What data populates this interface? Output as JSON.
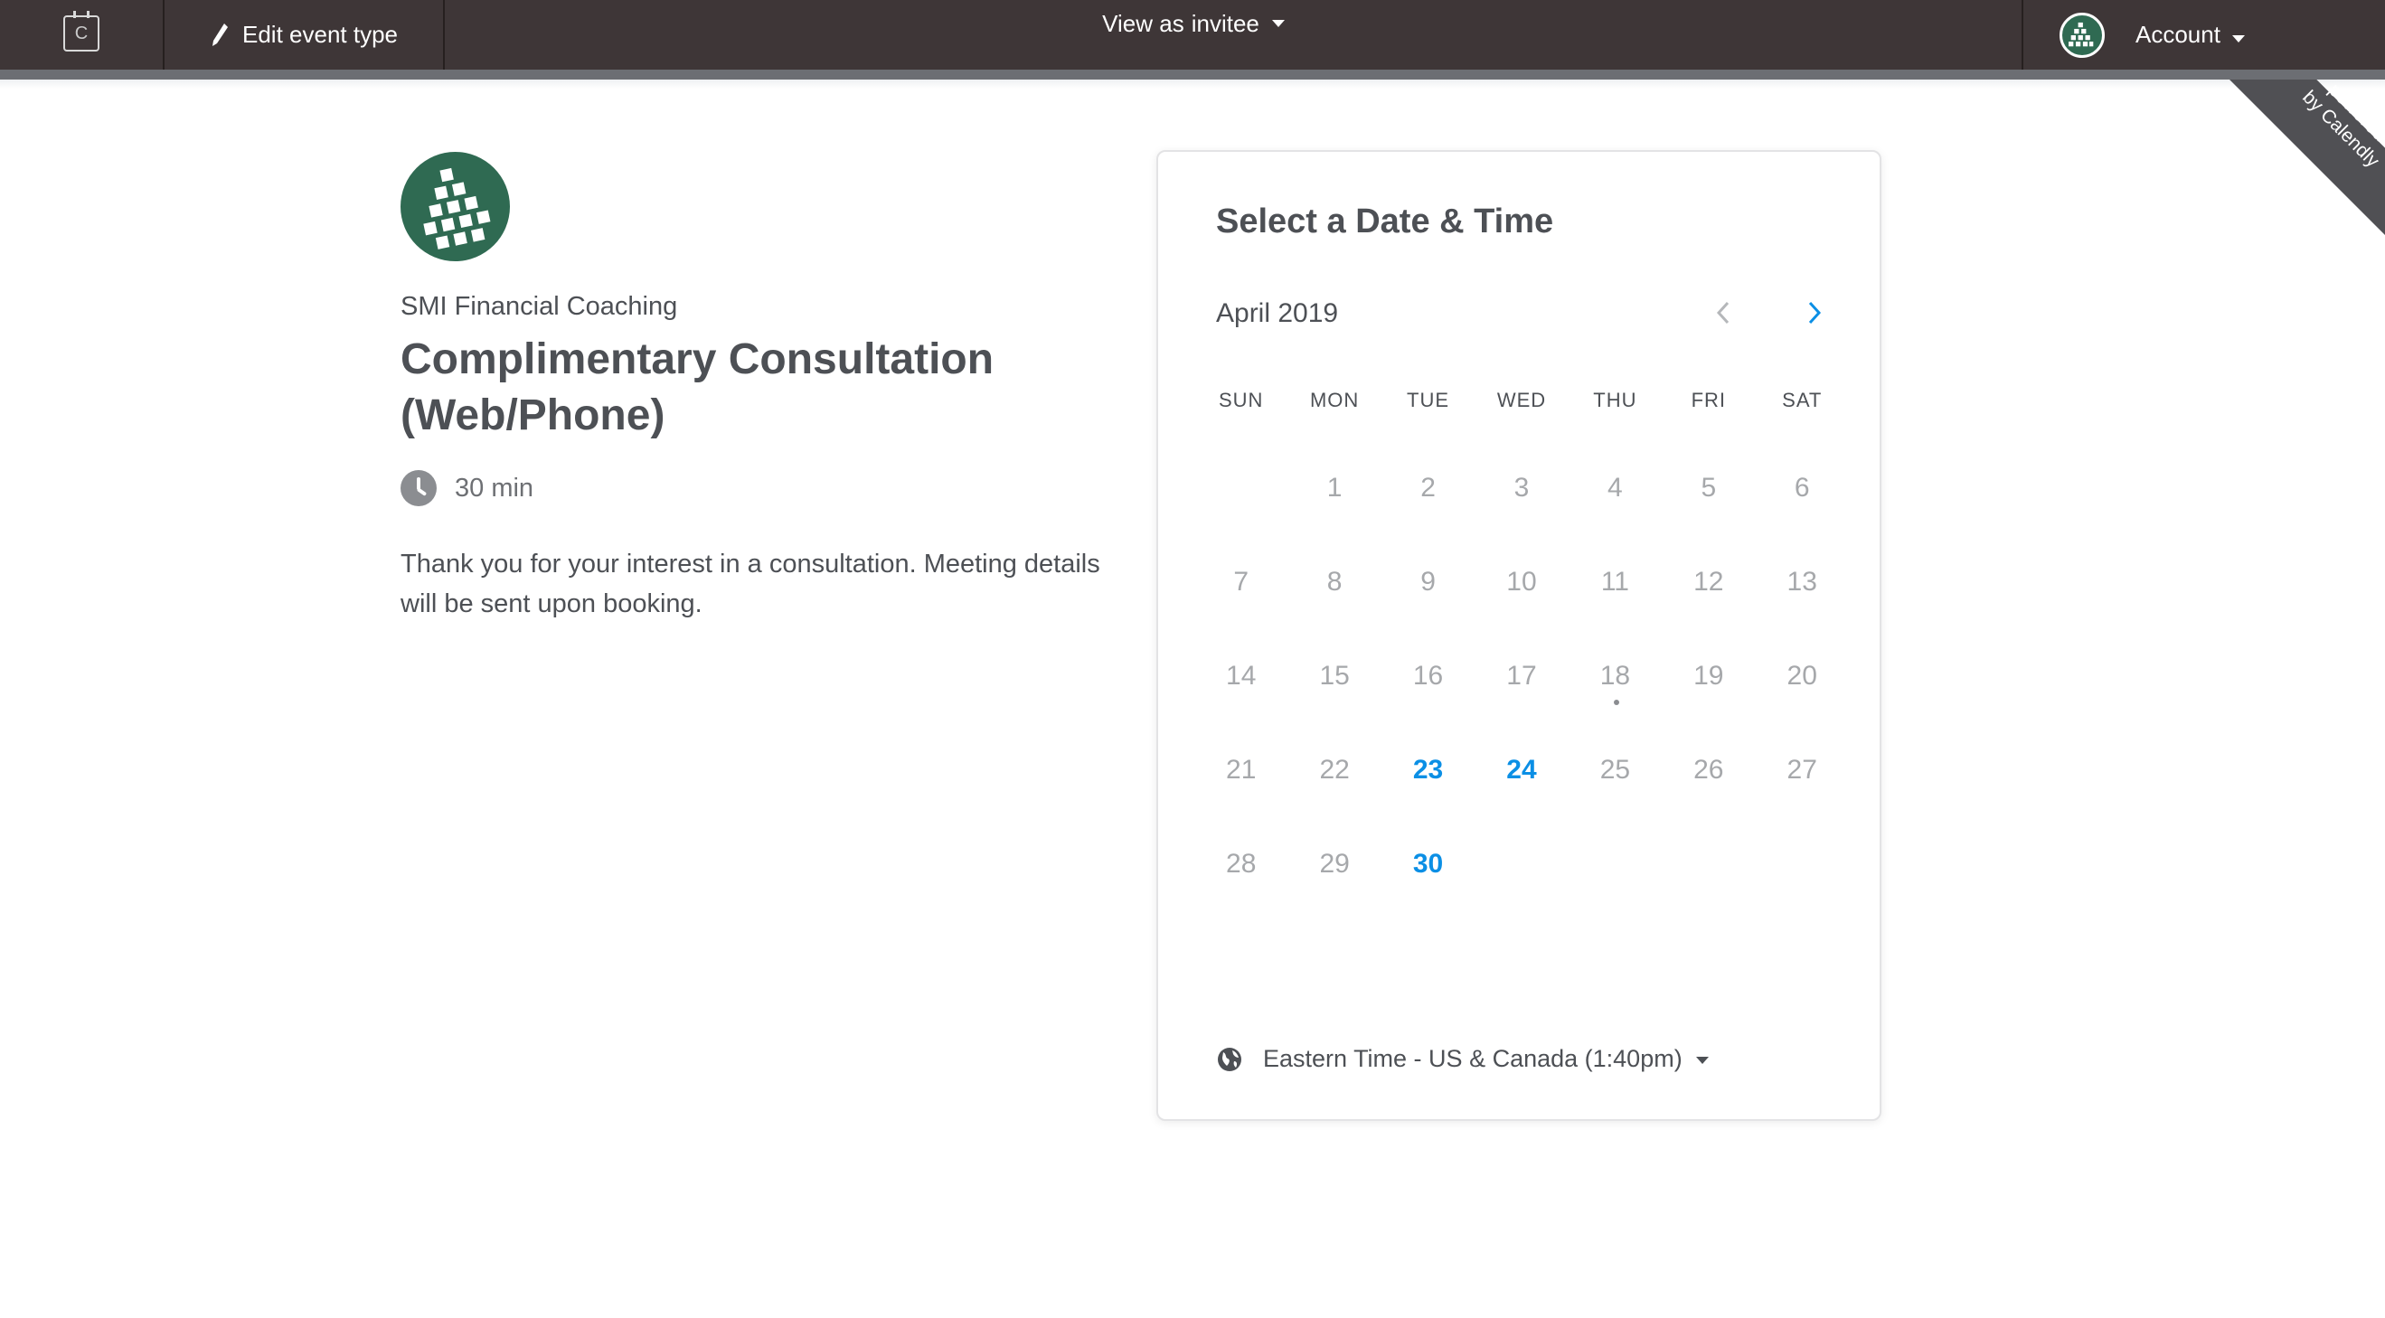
{
  "topbar": {
    "logo_letter": "C",
    "edit_label": "Edit event type",
    "view_as_prefix": "View as",
    "view_as_value": "invitee",
    "account_label": "Account"
  },
  "badge": {
    "line1": "powered",
    "line2": "by Calendly"
  },
  "event": {
    "organization": "SMI Financial Coaching",
    "title": "Complimentary Consultation (Web/Phone)",
    "duration": "30 min",
    "description": "Thank you for your interest in a consultation. Meeting details will be sent upon booking."
  },
  "calendar": {
    "heading": "Select a Date & Time",
    "month": "April 2019",
    "weekdays": [
      "SUN",
      "MON",
      "TUE",
      "WED",
      "THU",
      "FRI",
      "SAT"
    ],
    "weeks": [
      [
        "",
        "1",
        "2",
        "3",
        "4",
        "5",
        "6"
      ],
      [
        "7",
        "8",
        "9",
        "10",
        "11",
        "12",
        "13"
      ],
      [
        "14",
        "15",
        "16",
        "17",
        "18",
        "19",
        "20"
      ],
      [
        "21",
        "22",
        "23",
        "24",
        "25",
        "26",
        "27"
      ],
      [
        "28",
        "29",
        "30",
        "",
        "",
        "",
        ""
      ]
    ],
    "available_days": [
      "23",
      "24",
      "30"
    ],
    "today": "18",
    "timezone": "Eastern Time - US & Canada (1:40pm)"
  },
  "colors": {
    "topbar": "#3e3637",
    "available": "#0b8fe5",
    "brand_green": "#2f6a52"
  }
}
